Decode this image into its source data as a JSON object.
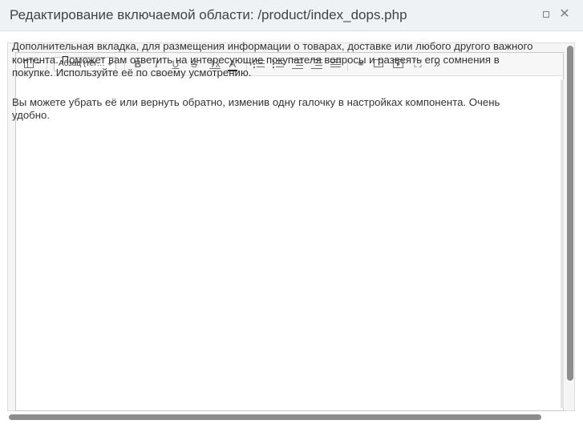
{
  "dialog": {
    "title": "Редактирование включаемой области: /product/index_dops.php",
    "maximize_icon": "maximize-icon",
    "close_glyph": "✕"
  },
  "toolbar": {
    "format_value": "Абзац (тег…",
    "bold": "B",
    "italic": "I",
    "underline": "U",
    "strike": "S",
    "remove_format": "Tx",
    "font_color": "A",
    "link_glyph": "⚭",
    "fullscreen_glyph": "⛶",
    "more_glyph": "»"
  },
  "content": {
    "paragraphs": [
      "Дополнительная вкладка, для размещения информации о товарах, доставке или любого другого важного контента. Поможет вам ответить на интересующие покупателя вопросы и развеять его сомнения в покупке. Используйте её по своему усмотрению.",
      "Вы можете убрать её или вернуть обратно, изменив одну галочку в настройках компонента. Очень удобно."
    ]
  }
}
